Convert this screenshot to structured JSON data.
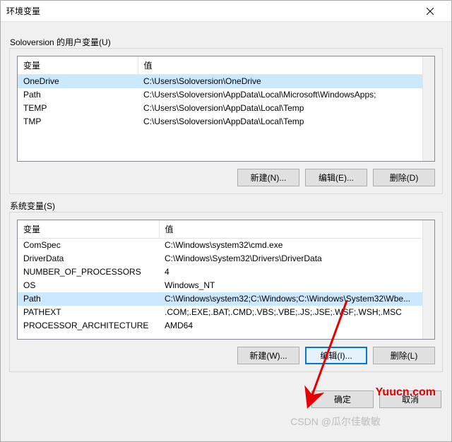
{
  "titlebar": {
    "title": "环境变量"
  },
  "user_section": {
    "label": "Soloversion 的用户变量(U)",
    "col_var": "变量",
    "col_val": "值",
    "rows": [
      {
        "name": "OneDrive",
        "value": "C:\\Users\\Soloversion\\OneDrive"
      },
      {
        "name": "Path",
        "value": "C:\\Users\\Soloversion\\AppData\\Local\\Microsoft\\WindowsApps;"
      },
      {
        "name": "TEMP",
        "value": "C:\\Users\\Soloversion\\AppData\\Local\\Temp"
      },
      {
        "name": "TMP",
        "value": "C:\\Users\\Soloversion\\AppData\\Local\\Temp"
      }
    ],
    "buttons": {
      "new": "新建(N)...",
      "edit": "编辑(E)...",
      "del": "删除(D)"
    }
  },
  "sys_section": {
    "label": "系统变量(S)",
    "col_var": "变量",
    "col_val": "值",
    "rows": [
      {
        "name": "ComSpec",
        "value": "C:\\Windows\\system32\\cmd.exe"
      },
      {
        "name": "DriverData",
        "value": "C:\\Windows\\System32\\Drivers\\DriverData"
      },
      {
        "name": "NUMBER_OF_PROCESSORS",
        "value": "4"
      },
      {
        "name": "OS",
        "value": "Windows_NT"
      },
      {
        "name": "Path",
        "value": "C:\\Windows\\system32;C:\\Windows;C:\\Windows\\System32\\Wbe..."
      },
      {
        "name": "PATHEXT",
        "value": ".COM;.EXE;.BAT;.CMD;.VBS;.VBE;.JS;.JSE;.WSF;.WSH;.MSC"
      },
      {
        "name": "PROCESSOR_ARCHITECTURE",
        "value": "AMD64"
      }
    ],
    "buttons": {
      "new": "新建(W)...",
      "edit": "编辑(I)...",
      "del": "删除(L)"
    }
  },
  "dialog_buttons": {
    "ok": "确定",
    "cancel": "取消"
  },
  "watermark": "Yuucn.com",
  "watermark2": "CSDN @瓜尔佳敏敏"
}
